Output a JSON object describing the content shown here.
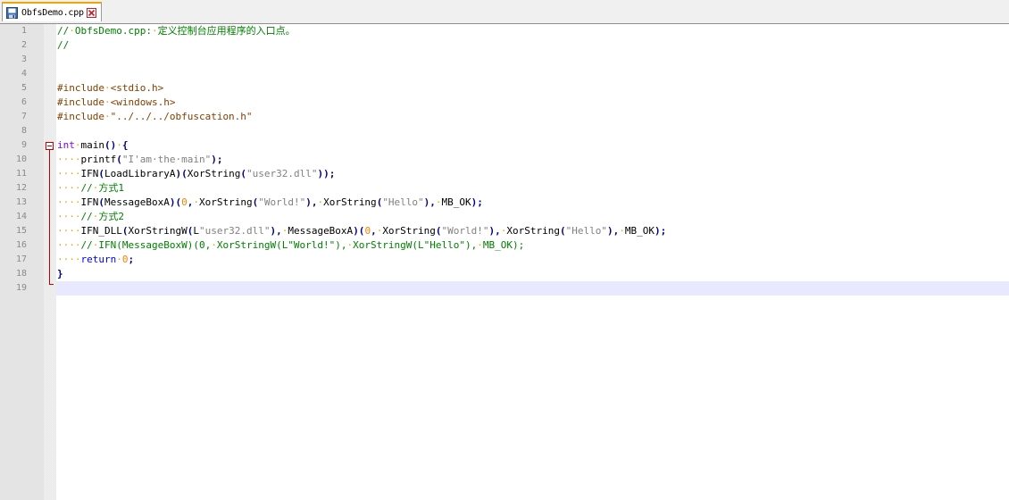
{
  "tab": {
    "filename": "ObfsDemo.cpp",
    "icon": "save-icon",
    "close_icon": "close-icon"
  },
  "colors": {
    "comment": "#008000",
    "preprocessor": "#804000",
    "keyword": "#0000ff",
    "type_keyword": "#8000ff",
    "string": "#808080",
    "number": "#ff8000",
    "operator": "#000080",
    "current_line": "#e8e8ff",
    "fold_marker": "#c00000"
  },
  "editor": {
    "current_line": 19,
    "lines": [
      {
        "n": "1",
        "tokens": [
          {
            "t": "//",
            "c": "comment"
          },
          {
            "t": "·",
            "c": "ws"
          },
          {
            "t": "ObfsDemo.cpp:",
            "c": "comment"
          },
          {
            "t": "·",
            "c": "ws"
          },
          {
            "t": "定义控制台应用程序的入口点。",
            "c": "comment"
          }
        ]
      },
      {
        "n": "2",
        "tokens": [
          {
            "t": "//",
            "c": "comment"
          }
        ]
      },
      {
        "n": "3",
        "tokens": []
      },
      {
        "n": "4",
        "tokens": []
      },
      {
        "n": "5",
        "tokens": [
          {
            "t": "#include",
            "c": "pre"
          },
          {
            "t": "·",
            "c": "ws"
          },
          {
            "t": "<stdio.h>",
            "c": "pre"
          }
        ]
      },
      {
        "n": "6",
        "tokens": [
          {
            "t": "#include",
            "c": "pre"
          },
          {
            "t": "·",
            "c": "ws"
          },
          {
            "t": "<windows.h>",
            "c": "pre"
          }
        ]
      },
      {
        "n": "7",
        "tokens": [
          {
            "t": "#include",
            "c": "pre"
          },
          {
            "t": "·",
            "c": "ws"
          },
          {
            "t": "\"../../../obfuscation.h\"",
            "c": "pre"
          }
        ]
      },
      {
        "n": "8",
        "tokens": []
      },
      {
        "n": "9",
        "tokens": [
          {
            "t": "int",
            "c": "kw2"
          },
          {
            "t": "·",
            "c": "ws"
          },
          {
            "t": "main",
            "c": "txt"
          },
          {
            "t": "()",
            "c": "op"
          },
          {
            "t": "·",
            "c": "ws"
          },
          {
            "t": "{",
            "c": "op"
          }
        ]
      },
      {
        "n": "10",
        "tokens": [
          {
            "t": "····",
            "c": "ws"
          },
          {
            "t": "printf",
            "c": "txt"
          },
          {
            "t": "(",
            "c": "op"
          },
          {
            "t": "\"I'am·the·main\"",
            "c": "str"
          },
          {
            "t": ");",
            "c": "op"
          }
        ]
      },
      {
        "n": "11",
        "tokens": [
          {
            "t": "····",
            "c": "ws"
          },
          {
            "t": "IFN",
            "c": "txt"
          },
          {
            "t": "(",
            "c": "op"
          },
          {
            "t": "LoadLibraryA",
            "c": "txt"
          },
          {
            "t": ")(",
            "c": "op"
          },
          {
            "t": "XorString",
            "c": "txt"
          },
          {
            "t": "(",
            "c": "op"
          },
          {
            "t": "\"user32.dll\"",
            "c": "str"
          },
          {
            "t": "));",
            "c": "op"
          }
        ]
      },
      {
        "n": "12",
        "tokens": [
          {
            "t": "····",
            "c": "ws"
          },
          {
            "t": "//",
            "c": "comment"
          },
          {
            "t": "·",
            "c": "ws"
          },
          {
            "t": "方式1",
            "c": "comment"
          }
        ]
      },
      {
        "n": "13",
        "tokens": [
          {
            "t": "····",
            "c": "ws"
          },
          {
            "t": "IFN",
            "c": "txt"
          },
          {
            "t": "(",
            "c": "op"
          },
          {
            "t": "MessageBoxA",
            "c": "txt"
          },
          {
            "t": ")(",
            "c": "op"
          },
          {
            "t": "0",
            "c": "num"
          },
          {
            "t": ",",
            "c": "op"
          },
          {
            "t": "·",
            "c": "ws"
          },
          {
            "t": "XorString",
            "c": "txt"
          },
          {
            "t": "(",
            "c": "op"
          },
          {
            "t": "\"World!\"",
            "c": "str"
          },
          {
            "t": "),",
            "c": "op"
          },
          {
            "t": "·",
            "c": "ws"
          },
          {
            "t": "XorString",
            "c": "txt"
          },
          {
            "t": "(",
            "c": "op"
          },
          {
            "t": "\"Hello\"",
            "c": "str"
          },
          {
            "t": "),",
            "c": "op"
          },
          {
            "t": "·",
            "c": "ws"
          },
          {
            "t": "MB_OK",
            "c": "txt"
          },
          {
            "t": ");",
            "c": "op"
          }
        ]
      },
      {
        "n": "14",
        "tokens": [
          {
            "t": "····",
            "c": "ws"
          },
          {
            "t": "//",
            "c": "comment"
          },
          {
            "t": "·",
            "c": "ws"
          },
          {
            "t": "方式2",
            "c": "comment"
          }
        ]
      },
      {
        "n": "15",
        "tokens": [
          {
            "t": "····",
            "c": "ws"
          },
          {
            "t": "IFN_DLL",
            "c": "txt"
          },
          {
            "t": "(",
            "c": "op"
          },
          {
            "t": "XorStringW",
            "c": "txt"
          },
          {
            "t": "(",
            "c": "op"
          },
          {
            "t": "L",
            "c": "txt"
          },
          {
            "t": "\"user32.dll\"",
            "c": "str"
          },
          {
            "t": "),",
            "c": "op"
          },
          {
            "t": "·",
            "c": "ws"
          },
          {
            "t": "MessageBoxA",
            "c": "txt"
          },
          {
            "t": ")(",
            "c": "op"
          },
          {
            "t": "0",
            "c": "num"
          },
          {
            "t": ",",
            "c": "op"
          },
          {
            "t": "·",
            "c": "ws"
          },
          {
            "t": "XorString",
            "c": "txt"
          },
          {
            "t": "(",
            "c": "op"
          },
          {
            "t": "\"World!\"",
            "c": "str"
          },
          {
            "t": "),",
            "c": "op"
          },
          {
            "t": "·",
            "c": "ws"
          },
          {
            "t": "XorString",
            "c": "txt"
          },
          {
            "t": "(",
            "c": "op"
          },
          {
            "t": "\"Hello\"",
            "c": "str"
          },
          {
            "t": "),",
            "c": "op"
          },
          {
            "t": "·",
            "c": "ws"
          },
          {
            "t": "MB_OK",
            "c": "txt"
          },
          {
            "t": ");",
            "c": "op"
          }
        ]
      },
      {
        "n": "16",
        "tokens": [
          {
            "t": "····",
            "c": "ws"
          },
          {
            "t": "//",
            "c": "comment"
          },
          {
            "t": "·",
            "c": "ws"
          },
          {
            "t": "IFN(MessageBoxW)(0,",
            "c": "comment"
          },
          {
            "t": "·",
            "c": "ws"
          },
          {
            "t": "XorStringW(L\"World!\"),",
            "c": "comment"
          },
          {
            "t": "·",
            "c": "ws"
          },
          {
            "t": "XorStringW(L\"Hello\"),",
            "c": "comment"
          },
          {
            "t": "·",
            "c": "ws"
          },
          {
            "t": "MB_OK);",
            "c": "comment"
          }
        ]
      },
      {
        "n": "17",
        "tokens": [
          {
            "t": "····",
            "c": "ws"
          },
          {
            "t": "return",
            "c": "kw"
          },
          {
            "t": "·",
            "c": "ws"
          },
          {
            "t": "0",
            "c": "num"
          },
          {
            "t": ";",
            "c": "op"
          }
        ]
      },
      {
        "n": "18",
        "tokens": [
          {
            "t": "}",
            "c": "op"
          }
        ]
      },
      {
        "n": "19",
        "tokens": []
      }
    ]
  }
}
